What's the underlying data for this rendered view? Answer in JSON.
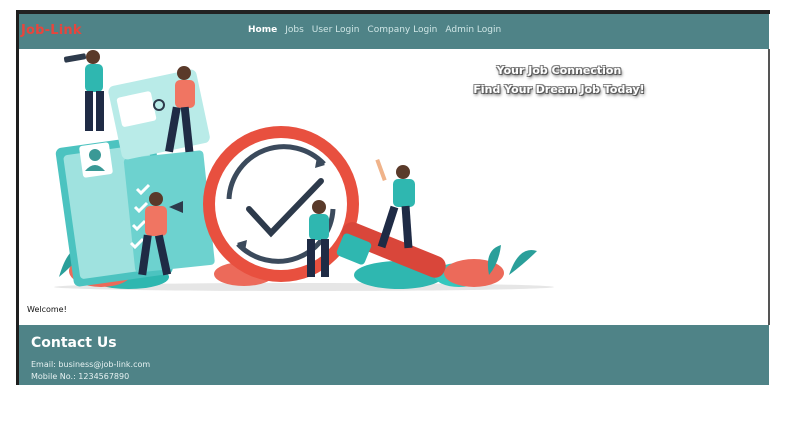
{
  "navbar": {
    "brand": "Job-Link",
    "links": [
      {
        "label": "Home",
        "active": true
      },
      {
        "label": "Jobs"
      },
      {
        "label": "User Login"
      },
      {
        "label": "Company Login"
      },
      {
        "label": "Admin Login"
      }
    ],
    "background": "#4f8387",
    "brand_color": "#e8453c"
  },
  "hero": {
    "line1": "Your Job Connection",
    "line2": "Find Your Dream Job Today!",
    "illustration": "job-search-illustration"
  },
  "main": {
    "welcome": "Welcome!"
  },
  "footer": {
    "title": "Contact Us",
    "email": "Email: business@job-link.com",
    "mobile": "Mobile No.: 1234567890"
  }
}
